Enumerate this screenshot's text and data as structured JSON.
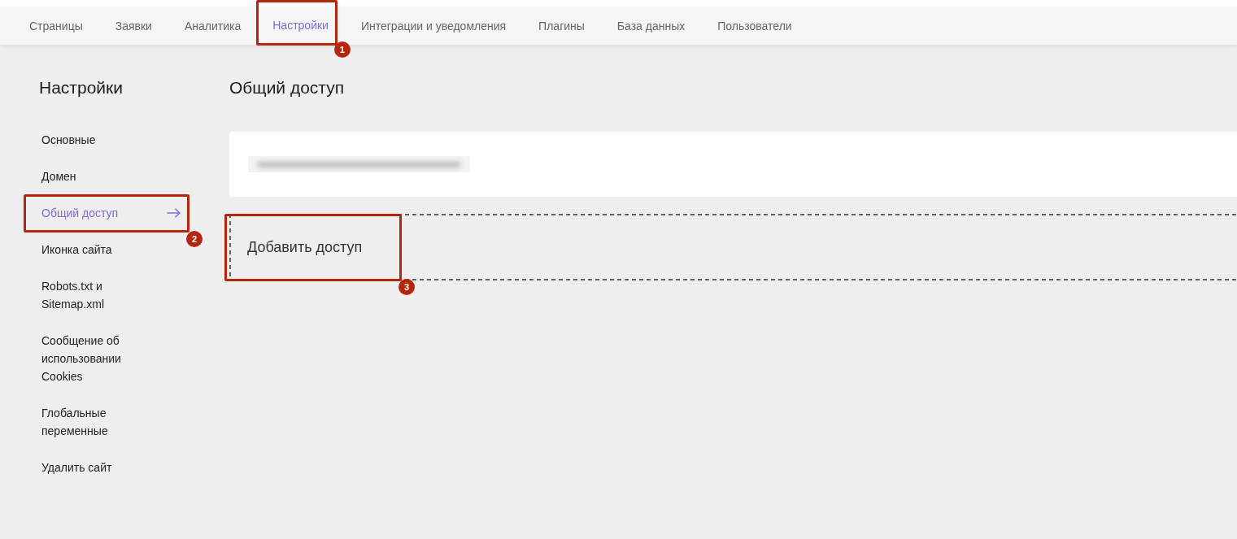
{
  "top_nav": {
    "tabs": [
      {
        "label": "Страницы",
        "selected": false
      },
      {
        "label": "Заявки",
        "selected": false
      },
      {
        "label": "Аналитика",
        "selected": false
      },
      {
        "label": "Настройки",
        "selected": true,
        "callout": "1"
      },
      {
        "label": "Интеграции и уведомления",
        "selected": false
      },
      {
        "label": "Плагины",
        "selected": false
      },
      {
        "label": "База данных",
        "selected": false
      },
      {
        "label": "Пользователи",
        "selected": false
      }
    ]
  },
  "sidebar": {
    "title": "Настройки",
    "items": [
      {
        "label": "Основные",
        "selected": false
      },
      {
        "label": "Домен",
        "selected": false
      },
      {
        "label": "Общий доступ",
        "selected": true,
        "callout": "2"
      },
      {
        "label": "Иконка сайта",
        "selected": false
      },
      {
        "label": "Robots.txt и Sitemap.xml",
        "selected": false
      },
      {
        "label": "Сообщение об использовании Cookies",
        "selected": false
      },
      {
        "label": "Глобальные переменные",
        "selected": false
      },
      {
        "label": "Удалить сайт",
        "selected": false
      }
    ]
  },
  "main": {
    "title": "Общий доступ",
    "access_entries": [
      {
        "redacted": true
      }
    ],
    "add_button": {
      "label": "Добавить доступ",
      "callout": "3"
    }
  }
}
